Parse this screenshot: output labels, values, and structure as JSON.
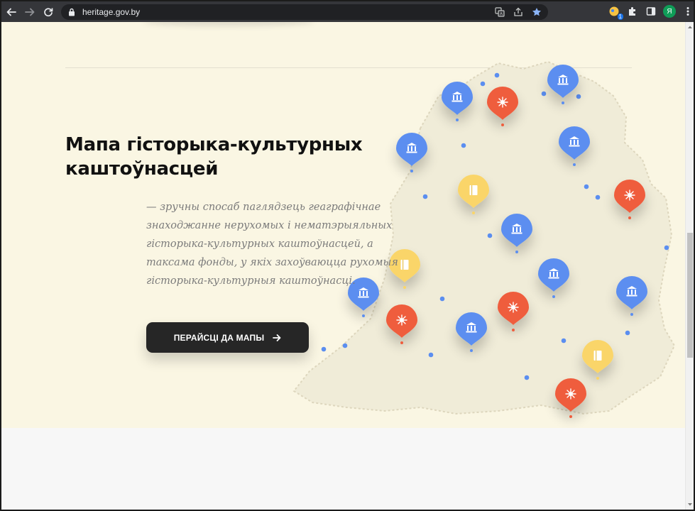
{
  "browser": {
    "url": "heritage.gov.by",
    "profile_initial": "Я",
    "extension_badge": "1"
  },
  "icons": {
    "back": "back-arrow-icon",
    "forward": "forward-arrow-icon",
    "reload": "reload-icon",
    "lock": "lock-icon",
    "translate": "translate-icon",
    "share": "share-icon",
    "bookmark": "star-icon",
    "extensions": "puzzle-icon",
    "side_panel": "side-panel-icon",
    "menu": "kebab-menu-icon",
    "cta_arrow": "arrow-right-icon"
  },
  "hero": {
    "title": "Мапа гісторыка-культурных каштоўнасцей",
    "description": "— зручны спосаб паглядзець геаграфічнае знаходжанне нерухомых і нематэрыяльных гісторыка-культурных каштоўнасцей, а таксама фонды, у якіх захоўваюцца рухомыя гісторыка-культурныя каштоўнасці.",
    "cta_label": "ПЕРАЙСЦІ ДА МАПЫ"
  },
  "map": {
    "marker_types": {
      "museum": {
        "color": "#5b8ef0",
        "icon": "museum-icon"
      },
      "intangible": {
        "color": "#ef5d3d",
        "icon": "sparkle-icon"
      },
      "fund": {
        "color": "#fad569",
        "icon": "book-icon"
      }
    },
    "colors": {
      "region_fill": "#f0ecd8",
      "region_border": "#ddd6bd",
      "dot": "#5b8ef0"
    }
  }
}
